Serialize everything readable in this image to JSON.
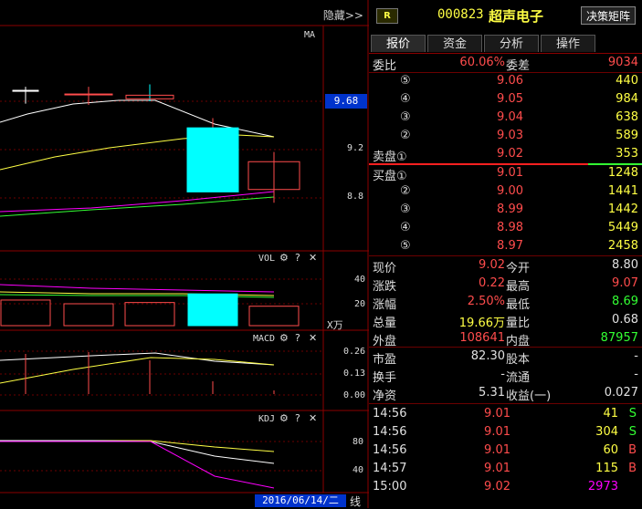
{
  "header": {
    "hide_label": "隐藏>>",
    "badge": "R",
    "stock_code": "000823",
    "stock_name": "超声电子",
    "decision_button": "决策矩阵"
  },
  "tabs": [
    "报价",
    "资金",
    "分析",
    "操作"
  ],
  "main_chart": {
    "label": "MA",
    "price_tag": "9.68",
    "y_ticks": [
      "9.2",
      "8.8"
    ],
    "candles": [
      {
        "open": 9.69,
        "close": 9.69,
        "high": 9.72,
        "low": 9.58
      },
      {
        "open": 9.66,
        "close": 9.66,
        "high": 9.72,
        "low": 9.57
      },
      {
        "open": 9.65,
        "close": 9.62,
        "high": 9.74,
        "low": 9.6
      },
      {
        "open": 8.85,
        "close": 9.38,
        "high": 9.46,
        "low": 8.85
      },
      {
        "open": 8.87,
        "close": 9.1,
        "high": 9.18,
        "low": 8.76
      }
    ]
  },
  "vol_panel": {
    "label": "VOL",
    "y_ticks": [
      "40",
      "20"
    ],
    "unit": "X万",
    "values": [
      23,
      20,
      21,
      28,
      18
    ]
  },
  "macd_panel": {
    "label": "MACD",
    "y_ticks": [
      "0.26",
      "0.13",
      "0.00"
    ]
  },
  "kdj_panel": {
    "label": "KDJ",
    "y_ticks": [
      "80",
      "40"
    ]
  },
  "bottom": {
    "date": "2016/06/14/二",
    "line_label": "线"
  },
  "wei": {
    "wb_label": "委比",
    "wb_value": "60.06%",
    "wc_label": "委差",
    "wc_value": "9034"
  },
  "sell": [
    {
      "label": "⑤",
      "price": "9.06",
      "vol": "440"
    },
    {
      "label": "④",
      "price": "9.05",
      "vol": "984"
    },
    {
      "label": "③",
      "price": "9.04",
      "vol": "638"
    },
    {
      "label": "②",
      "price": "9.03",
      "vol": "589"
    },
    {
      "label": "卖盘①",
      "price": "9.02",
      "vol": "353"
    }
  ],
  "buy": [
    {
      "label": "买盘①",
      "price": "9.01",
      "vol": "1248"
    },
    {
      "label": "②",
      "price": "9.00",
      "vol": "1441"
    },
    {
      "label": "③",
      "price": "8.99",
      "vol": "1442"
    },
    {
      "label": "④",
      "price": "8.98",
      "vol": "5449"
    },
    {
      "label": "⑤",
      "price": "8.97",
      "vol": "2458"
    }
  ],
  "quote": [
    {
      "l1": "现价",
      "v1": "9.02",
      "c1": "red",
      "l2": "今开",
      "v2": "8.80",
      "c2": "wht"
    },
    {
      "l1": "涨跌",
      "v1": "0.22",
      "c1": "red",
      "l2": "最高",
      "v2": "9.07",
      "c2": "red"
    },
    {
      "l1": "涨幅",
      "v1": "2.50%",
      "c1": "red",
      "l2": "最低",
      "v2": "8.69",
      "c2": "grn"
    },
    {
      "l1": "总量",
      "v1": "19.66万",
      "c1": "yel",
      "l2": "量比",
      "v2": "0.68",
      "c2": "wht"
    },
    {
      "l1": "外盘",
      "v1": "108641",
      "c1": "red",
      "l2": "内盘",
      "v2": "87957",
      "c2": "grn"
    }
  ],
  "fundamentals": [
    {
      "l1": "市盈",
      "v1": "82.30",
      "l2": "股本",
      "v2": "-"
    },
    {
      "l1": "换手",
      "v1": "-",
      "l2": "流通",
      "v2": "-"
    },
    {
      "l1": "净资",
      "v1": "5.31",
      "l2": "收益(一)",
      "v2": "0.027"
    }
  ],
  "ticks": [
    {
      "time": "14:56",
      "price": "9.01",
      "vol": "41",
      "vc": "yel",
      "side": "S",
      "sc": "grn"
    },
    {
      "time": "14:56",
      "price": "9.01",
      "vol": "304",
      "vc": "yel",
      "side": "S",
      "sc": "grn"
    },
    {
      "time": "14:56",
      "price": "9.01",
      "vol": "60",
      "vc": "yel",
      "side": "B",
      "sc": "red"
    },
    {
      "time": "14:57",
      "price": "9.01",
      "vol": "115",
      "vc": "yel",
      "side": "B",
      "sc": "red"
    },
    {
      "time": "15:00",
      "price": "9.02",
      "vol": "2973",
      "vc": "mag",
      "side": "",
      "sc": "grn"
    }
  ],
  "colors": {
    "up": "#ff4c4c",
    "down_fill": "#00ffff",
    "ma1": "#ffffff",
    "ma2": "#ffff44",
    "ma3": "#ff00ff",
    "ma4": "#33ff33"
  }
}
